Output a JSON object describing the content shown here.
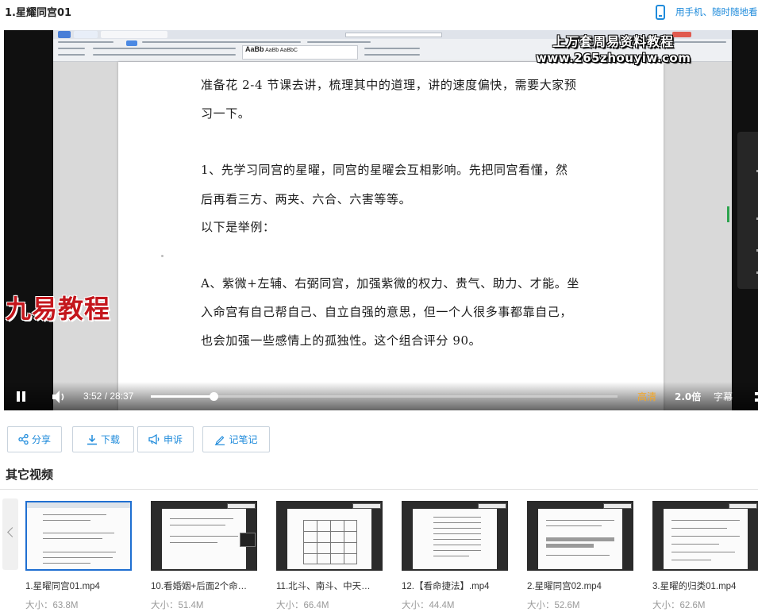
{
  "page": {
    "title": "1.星耀同宫01",
    "mobile_hint": "用手机、随时随地看"
  },
  "player": {
    "watermark_line1": "上万套周易资料教程",
    "watermark_line2": "www.265zhouyiw.com",
    "watermark_left": "九易教程",
    "document_lines": [
      "准备花 2-4 节课去讲，梳理其中的道理，讲的速度偏快，需要大家预",
      "习一下。",
      "1、先学习同宫的星曜，同宫的星曜会互相影响。先把同宫看懂，然",
      "后再看三方、两夹、六合、六害等等。",
      "以下是举例：",
      "A、紫微+左辅、右弼同宫，加强紫微的权力、贵气、助力、才能。坐",
      "入命宫有自己帮自己、自立自强的意思，但一个人很多事都靠自己，",
      "也会加强一些感情上的孤独性。这个组合评分 90。"
    ],
    "current_time": "3:52",
    "duration": "28:37",
    "time_display": "3:52 / 28:37",
    "progress": 0.135,
    "quality_label": "高清",
    "speed_label": "2.0倍",
    "subtitle_label": "字幕"
  },
  "actions": {
    "share": "分享",
    "download": "下载",
    "report": "申诉",
    "note": "记笔记"
  },
  "colors": {
    "accent": "#1f8bdb",
    "quality": "#f5a623",
    "watermark_red": "#c4161c"
  },
  "other_videos": {
    "title": "其它视频",
    "items": [
      {
        "name": "1.星曜同宫01.mp4",
        "size": "大小：63.8M",
        "active": true
      },
      {
        "name": "10.看婚姻+后面2个命…",
        "size": "大小：51.4M",
        "active": false
      },
      {
        "name": "11.北斗、南斗、中天…",
        "size": "大小：66.4M",
        "active": false
      },
      {
        "name": "12.【看命捷法】.mp4",
        "size": "大小：44.4M",
        "active": false
      },
      {
        "name": "2.星曜同宫02.mp4",
        "size": "大小：52.6M",
        "active": false
      },
      {
        "name": "3.星曜的归类01.mp4",
        "size": "大小：62.6M",
        "active": false
      }
    ]
  }
}
